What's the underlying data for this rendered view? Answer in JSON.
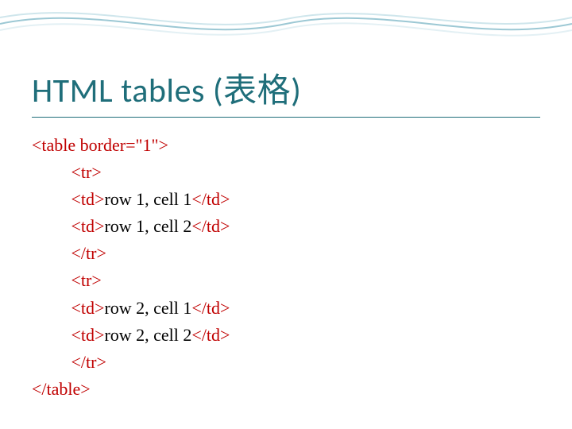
{
  "title": "HTML tables (表格)",
  "code": {
    "l1_tag": "<table border=\"1\">",
    "l2_tag": "<tr>",
    "l3_tag_open": "<td>",
    "l3_text": "row 1, cell 1",
    "l3_tag_close": "</td>",
    "l4_tag_open": "<td>",
    "l4_text": "row 1, cell 2",
    "l4_tag_close": "</td>",
    "l5_tag": "</tr>",
    "l6_tag": "<tr>",
    "l7_tag_open": "<td>",
    "l7_text": "row 2, cell 1",
    "l7_tag_close": "</td>",
    "l8_tag_open": "<td>",
    "l8_text": "row 2, cell 2",
    "l8_tag_close": "</td>",
    "l9_tag": "</tr>",
    "l10_tag": "</table>"
  }
}
